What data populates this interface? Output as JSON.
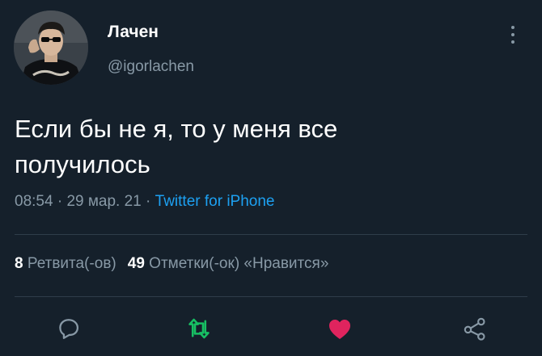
{
  "tweet": {
    "author": {
      "display_name": "Лачен",
      "username": "@igorlachen"
    },
    "text_line1": "Если бы не я, то у меня все",
    "text_line2": "получилось",
    "time": "08:54",
    "date": "29 мар. 21",
    "separator": " · ",
    "source": "Twitter for iPhone",
    "stats": {
      "retweets_count": "8",
      "retweets_label": "Ретвита(-ов)",
      "likes_count": "49",
      "likes_label": "Отметки(-ок) «Нравится»"
    }
  },
  "icons": {
    "menu": "more-vertical-icon",
    "reply": "reply-icon",
    "retweet": "retweet-icon",
    "like": "heart-icon",
    "share": "share-icon"
  },
  "colors": {
    "background": "#15202b",
    "secondary_text": "#8899a6",
    "link": "#1da1f2",
    "retweet": "#17bf63",
    "like": "#e0245e"
  }
}
